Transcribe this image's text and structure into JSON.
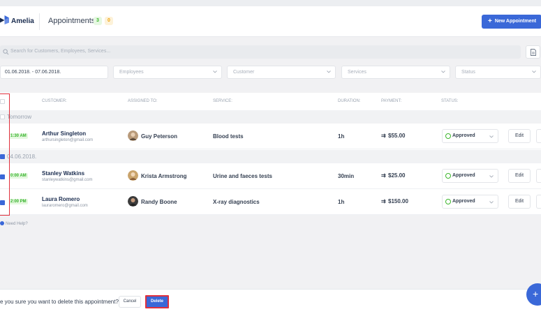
{
  "header": {
    "brand": "Amelia",
    "title": "Appointments",
    "count_approved": "3",
    "count_pending": "0",
    "new_button": "New Appointment",
    "brand_color": "#3a68d8"
  },
  "search": {
    "placeholder": "Search for Customers, Employees, Services..."
  },
  "filters": {
    "date_range": "01.06.2018. - 07.06.2018.",
    "employees": "Employees",
    "customer": "Customer",
    "services": "Services",
    "status": "Status"
  },
  "columns": {
    "customer": "CUSTOMER:",
    "assigned": "ASSIGNED TO:",
    "service": "SERVICE:",
    "duration": "DURATION:",
    "payment": "PAYMENT:",
    "status": "STATUS:"
  },
  "groups": [
    {
      "label": "Tomorrow"
    },
    {
      "label": "04.06.2018."
    }
  ],
  "appointments": [
    {
      "time": "1:30 AM",
      "customer": "Arthur Singleton",
      "email": "arthursingleton@gmail.com",
      "employee": "Guy Peterson",
      "service": "Blood tests",
      "duration": "1h",
      "payment": "$55.00",
      "status": "Approved",
      "edit": "Edit"
    },
    {
      "time": "0:00 AM",
      "customer": "Stanley Watkins",
      "email": "stanleywatkins@gmail.com",
      "employee": "Krista Armstrong",
      "service": "Urine and faeces tests",
      "duration": "30min",
      "payment": "$25.00",
      "status": "Approved",
      "edit": "Edit"
    },
    {
      "time": "2:00 PM",
      "customer": "Laura Romero",
      "email": "lauraromero@gmail.com",
      "employee": "Randy Boone",
      "service": "X-ray diagnostics",
      "duration": "1h",
      "payment": "$150.00",
      "status": "Approved",
      "edit": "Edit"
    }
  ],
  "help": "Need Help?",
  "confirm_bar": {
    "message": "e you sure you want to delete this appointment?",
    "cancel": "Cancel",
    "delete": "Delete"
  },
  "fab": "+"
}
